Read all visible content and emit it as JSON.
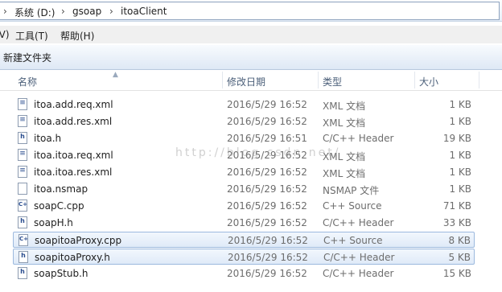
{
  "address": {
    "segments": [
      "系统 (D:)",
      "gsoap",
      "itoaClient"
    ],
    "separators": [
      "›",
      "›",
      "›"
    ]
  },
  "menu": {
    "items": [
      "(V)",
      "工具(T)",
      "帮助(H)"
    ]
  },
  "toolbar": {
    "new_folder": "新建文件夹"
  },
  "columns": {
    "name": "名称",
    "date": "修改日期",
    "type": "类型",
    "size": "大小"
  },
  "files": [
    {
      "name": "itoa.add.req.xml",
      "date": "2016/5/29 16:52",
      "type": "XML 文档",
      "size": "1 KB",
      "icon": "xml-file-icon"
    },
    {
      "name": "itoa.add.res.xml",
      "date": "2016/5/29 16:52",
      "type": "XML 文档",
      "size": "1 KB",
      "icon": "xml-file-icon"
    },
    {
      "name": "itoa.h",
      "date": "2016/5/29 16:51",
      "type": "C/C++ Header",
      "size": "19 KB",
      "icon": "header-file-icon"
    },
    {
      "name": "itoa.itoa.req.xml",
      "date": "2016/5/29 16:52",
      "type": "XML 文档",
      "size": "1 KB",
      "icon": "xml-file-icon"
    },
    {
      "name": "itoa.itoa.res.xml",
      "date": "2016/5/29 16:52",
      "type": "XML 文档",
      "size": "1 KB",
      "icon": "xml-file-icon"
    },
    {
      "name": "itoa.nsmap",
      "date": "2016/5/29 16:52",
      "type": "NSMAP 文件",
      "size": "1 KB",
      "icon": "file-icon"
    },
    {
      "name": "soapC.cpp",
      "date": "2016/5/29 16:52",
      "type": "C++ Source",
      "size": "71 KB",
      "icon": "cpp-file-icon"
    },
    {
      "name": "soapH.h",
      "date": "2016/5/29 16:52",
      "type": "C/C++ Header",
      "size": "33 KB",
      "icon": "header-file-icon"
    },
    {
      "name": "soapitoaProxy.cpp",
      "date": "2016/5/29 16:52",
      "type": "C++ Source",
      "size": "8 KB",
      "icon": "cpp-file-icon",
      "selected": true
    },
    {
      "name": "soapitoaProxy.h",
      "date": "2016/5/29 16:52",
      "type": "C/C++ Header",
      "size": "5 KB",
      "icon": "header-file-icon",
      "selected": true
    },
    {
      "name": "soapStub.h",
      "date": "2016/5/29 16:52",
      "type": "C/C++ Header",
      "size": "15 KB",
      "icon": "header-file-icon"
    }
  ],
  "watermark": "http://blog.csdn.net/"
}
